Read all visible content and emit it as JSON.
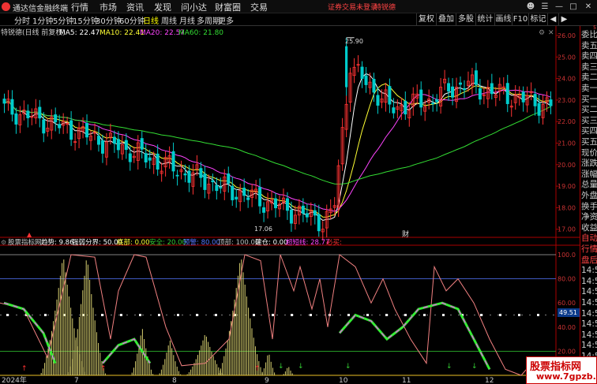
{
  "titlebar": {
    "app_name": "通达信金融终端",
    "menu": [
      "行情",
      "市场",
      "资讯",
      "发现",
      "问小达",
      "财富圈",
      "交易"
    ],
    "broker_status": "证券交易未登录",
    "stock_tag": "特锐德"
  },
  "toolbar": {
    "periods": [
      "分时",
      "1分钟",
      "5分钟",
      "15分钟",
      "30分钟",
      "60分钟",
      "日线",
      "周线",
      "月线",
      "多周期",
      "更多"
    ],
    "active_period": "日线",
    "tools": [
      "复权",
      "叠加",
      "多股",
      "统计",
      "画线",
      "F10",
      "标记"
    ]
  },
  "main_chart": {
    "stock_title": "特锐德(日线 前复权)",
    "ma_labels": [
      {
        "text": "MA5: 22.47",
        "color": "#ffffff"
      },
      {
        "text": "MA10: 22.41",
        "color": "#ffff33"
      },
      {
        "text": "MA20: 22.57",
        "color": "#ff44ff"
      },
      {
        "text": "MA60: 21.80",
        "color": "#33dd33"
      }
    ],
    "high_label": "25.90",
    "low_label": "17.06",
    "event_marker": "财",
    "y_ticks": [
      "26.00",
      "25.00",
      "24.00",
      "23.00",
      "22.00",
      "21.00",
      "20.00",
      "19.00",
      "18.00",
      "17.00"
    ],
    "colors": {
      "up": "#ff3333",
      "down": "#00cccc",
      "ma5": "#ffffff",
      "ma10": "#ffff33",
      "ma20": "#ff44ff",
      "ma60": "#33dd33"
    }
  },
  "indicator": {
    "name": "股票指标网",
    "values": [
      {
        "text": "趋势: 9.86",
        "color": "#ffffff"
      },
      {
        "text": "强弱分界: 50.00",
        "color": "#ffffff"
      },
      {
        "text": "底部: 0.00",
        "color": "#ffff33"
      },
      {
        "text": "安全: 20.00",
        "color": "#33cc33"
      },
      {
        "text": "预警: 80.00",
        "color": "#5577ff"
      },
      {
        "text": "顶部: 100.00",
        "color": "#bbbbbb"
      },
      {
        "text": "建仓: 0.00",
        "color": "#ffffff"
      },
      {
        "text": "超短线: 28.77",
        "color": "#ff44ff"
      },
      {
        "text": "必买:",
        "color": "#ff3333"
      }
    ],
    "y_ticks": [
      "100.0",
      "80.00",
      "60.00",
      "40.00",
      "20.00"
    ],
    "current_value": "49.51"
  },
  "time_axis": {
    "labels": [
      "2024年",
      "7",
      "8",
      "9",
      "10",
      "11",
      "12"
    ]
  },
  "right_panel": {
    "labels": [
      "委比",
      "卖五",
      "卖四",
      "卖三",
      "卖二",
      "卖一",
      "买一",
      "买二",
      "买三",
      "买四",
      "买五",
      "现价",
      "涨跌",
      "涨幅",
      "总量",
      "外盘",
      "换手",
      "净资",
      "收益",
      "自动",
      "行情",
      "盘后",
      "14:5",
      "14:5",
      "14:5",
      "14:5",
      "14:5",
      "14:5",
      "14:5",
      "14:5",
      "14:5",
      "14:5"
    ],
    "header_small": "5"
  },
  "watermark": {
    "title": "股票指标网",
    "url": "www.7gpzb.com"
  }
}
